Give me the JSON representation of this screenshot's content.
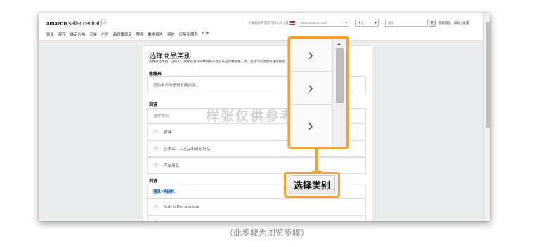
{
  "header": {
    "logo_bold": "amazon",
    "logo_rest": " seller central",
    "nav": [
      "目录",
      "库存",
      "确定价格",
      "订单",
      "广告",
      "品牌旗舰店",
      "程序",
      "数据报告",
      "绩效",
      "应用和服务",
      "B2B"
    ],
    "account_text": "小米数码专营店有限公司 | 美国",
    "marketplace": "www.amazon.com",
    "language": "中文",
    "search_placeholder": "搜索",
    "top_links": "买家消息 | 帮助 | 设置"
  },
  "panel": {
    "title": "选择商品类别",
    "description": "选择最佳类别，这样可以确保您看到的数据最适合您商品的数据输入项。直接浏览类别或使用搜索。",
    "description_link": "看看您的搜索结果",
    "favorites_heading": "收藏夹",
    "favorites_empty": "您尚未添加任何收藏类别。",
    "browse_heading": "浏览",
    "browse_placeholder": "搜索类别",
    "categories": [
      "器具",
      "艺术品、工艺品和缝纫用品",
      "汽车用品"
    ],
    "browse_heading_2": "浏览",
    "breadcrumb_root": "器具",
    "breadcrumb_sep": " > ",
    "breadcrumb_leaf": "洗碗机",
    "subcategory": "Built-In Dishwashers"
  },
  "popup": {
    "arrows": [
      "›",
      "›",
      "›"
    ],
    "scroll_up": "▲"
  },
  "select_category_button": "选择类别",
  "watermark": "样张仅供参考",
  "caption": "（此步骤为浏览步骤）",
  "colors": {
    "highlight": "#f3a22c",
    "link": "#0066c0"
  }
}
